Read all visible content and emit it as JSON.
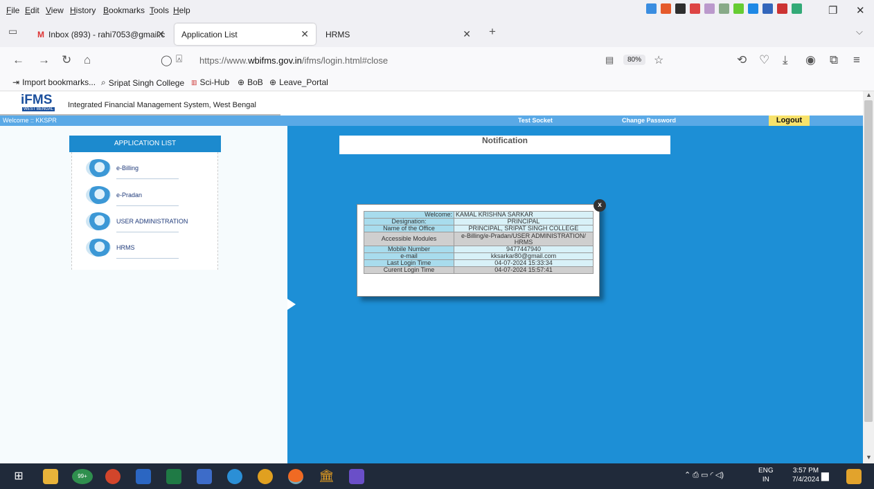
{
  "menubar": {
    "items": [
      "File",
      "Edit",
      "View",
      "History",
      "Bookmarks",
      "Tools",
      "Help"
    ]
  },
  "tabs": [
    {
      "label": "Inbox (893) - rahi7053@gmail.c",
      "icon": "gmail-icon"
    },
    {
      "label": "Application List",
      "icon": ""
    },
    {
      "label": "HRMS",
      "icon": ""
    }
  ],
  "nav": {
    "url_prefix": "https://www.",
    "url_domain": "wbifms.gov.in",
    "url_path": "/ifms/login.html#close",
    "zoom": "80%"
  },
  "bookmarks": [
    "Import bookmarks...",
    "Sripat Singh College",
    "Sci-Hub",
    "BoB",
    "Leave_Portal"
  ],
  "site": {
    "brand": "iFMS",
    "brand_sub": "WEST BENGAL",
    "title": "Integrated Financial Management System, West Bengal",
    "welcome": "Welcome :: KKSPR",
    "test_socket": "Test Socket",
    "change_password": "Change Password",
    "logout": "Logout"
  },
  "applist": {
    "heading": "APPLICATION LIST",
    "items": [
      "e-Billing",
      "e-Pradan",
      "USER ADMINISTRATION",
      "HRMS"
    ]
  },
  "notification": {
    "title": "Notification"
  },
  "popup": {
    "close": "x",
    "rows": [
      {
        "k": "Welcome:",
        "v": "KAMAL KRISHNA SARKAR"
      },
      {
        "k": "Designation:",
        "v": "PRINCIPAL"
      },
      {
        "k": "Name of the Office",
        "v": "PRINCIPAL, SRIPAT SINGH COLLEGE"
      },
      {
        "k": "Accessible Modules",
        "v": "e-Billing/e-Pradan/USER ADMINISTRATION/ HRMS"
      },
      {
        "k": "Mobile Number",
        "v": "9477447940"
      },
      {
        "k": "e-mail",
        "v": "kksarkar80@gmail.com"
      },
      {
        "k": "Last Login Time",
        "v": "04-07-2024 15:33:34"
      },
      {
        "k": "Curent Login Time",
        "v": "04-07-2024 15:57:41"
      }
    ]
  },
  "taskbar": {
    "badge": "99+",
    "lang": "ENG",
    "region": "IN",
    "time": "3:57 PM",
    "date": "7/4/2024"
  },
  "colors": {
    "page_blue": "#1d8fd6",
    "bar_blue": "#5aa9e6",
    "logout_yellow": "#f7e26b"
  }
}
